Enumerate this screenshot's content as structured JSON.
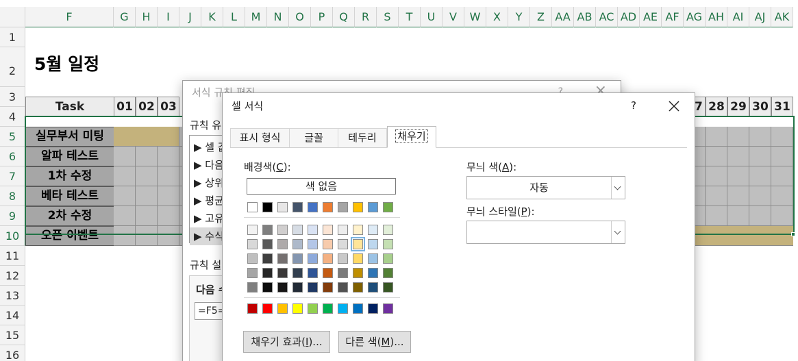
{
  "sheet": {
    "columns": [
      "F",
      "G",
      "H",
      "I",
      "J",
      "K",
      "L",
      "M",
      "N",
      "O",
      "P",
      "Q",
      "R",
      "S",
      "T",
      "U",
      "V",
      "W",
      "X",
      "Y",
      "Z",
      "AA",
      "AB",
      "AC",
      "AD",
      "AE",
      "AF",
      "AG",
      "AH",
      "AI",
      "AJ",
      "AK"
    ],
    "rows": [
      "1",
      "2",
      "3",
      "4",
      "5",
      "6",
      "7",
      "8",
      "9",
      "10",
      "11",
      "12",
      "13",
      "14",
      "15",
      "16"
    ],
    "title": "5월 일정",
    "task_header": "Task",
    "days_left": [
      "01",
      "02",
      "03"
    ],
    "days_right": [
      "27",
      "28",
      "29",
      "30",
      "31"
    ],
    "day_partial": "7",
    "tasks": [
      "실무부서 미팅",
      "알파 테스트",
      "1차 수정",
      "베타 테스트",
      "2차 수정",
      "오픈 이벤트"
    ],
    "colors": {
      "grid_fill": "#bfbfbf",
      "task_fill": "#a6a6a6",
      "schedule_fill": "#c4b27c",
      "accent": "#217346"
    }
  },
  "back_dialog": {
    "title": "서식 규칙 편집",
    "help": "?",
    "close": "×",
    "rule_type_label": "규칙 유",
    "rule_items": [
      "▶ 셀 값",
      "▶ 다음",
      "▶ 상위",
      "▶ 평균",
      "▶ 고유",
      "▶ 수식"
    ],
    "rule_desc_label": "규칙 설",
    "formula_label": "다음 수",
    "formula_value": "=F5="
  },
  "dialog": {
    "title": "셀 서식",
    "help": "?",
    "close_icon": "close-icon",
    "tabs": [
      "표시 형식",
      "글꼴",
      "테두리",
      "채우기"
    ],
    "active_tab": "채우기",
    "bg_color_label": "배경색(",
    "bg_color_key": "C",
    "no_color": "색 없음",
    "pattern_color_label": "무늬 색(",
    "pattern_color_key": "A",
    "pattern_color_value": "자동",
    "pattern_style_label": "무늬 스타일(",
    "pattern_style_key": "P",
    "label_close": "):",
    "fill_effects": "채우기 효과(",
    "fill_effects_key": "I",
    "more_colors": "다른 색(",
    "more_colors_key": "M",
    "btn_suffix": ")...",
    "theme_top": [
      "#ffffff",
      "#000000",
      "#e7e6e6",
      "#44546a",
      "#4472c4",
      "#ed7d31",
      "#a5a5a5",
      "#ffc000",
      "#5b9bd5",
      "#70ad47"
    ],
    "theme_shades": [
      [
        "#f2f2f2",
        "#7f7f7f",
        "#d0cece",
        "#d6dce4",
        "#d9e2f3",
        "#fbe5d5",
        "#ededed",
        "#fff2cc",
        "#deebf6",
        "#e2efd9"
      ],
      [
        "#d8d8d8",
        "#595959",
        "#aeaaaa",
        "#adb9ca",
        "#b4c6e7",
        "#f7cbac",
        "#dbdbdb",
        "#fee599",
        "#bdd7ee",
        "#c5e0b3"
      ],
      [
        "#bfbfbf",
        "#3f3f3f",
        "#757070",
        "#8496b0",
        "#8eaadb",
        "#f4b183",
        "#c9c9c9",
        "#ffd965",
        "#9cc3e5",
        "#a8d08d"
      ],
      [
        "#a5a5a5",
        "#262626",
        "#3a3838",
        "#323f4f",
        "#2f5496",
        "#c55a11",
        "#7b7b7b",
        "#bf8f00",
        "#2e75b5",
        "#538135"
      ],
      [
        "#7f7f7f",
        "#0c0c0c",
        "#171616",
        "#222a35",
        "#1f3864",
        "#833c0b",
        "#525252",
        "#7f6000",
        "#1e4e79",
        "#375623"
      ]
    ],
    "standard": [
      "#c00000",
      "#ff0000",
      "#ffc000",
      "#ffff00",
      "#92d050",
      "#00b050",
      "#00b0f0",
      "#0070c0",
      "#002060",
      "#7030a0"
    ],
    "selected_swatch": "#fee599"
  }
}
